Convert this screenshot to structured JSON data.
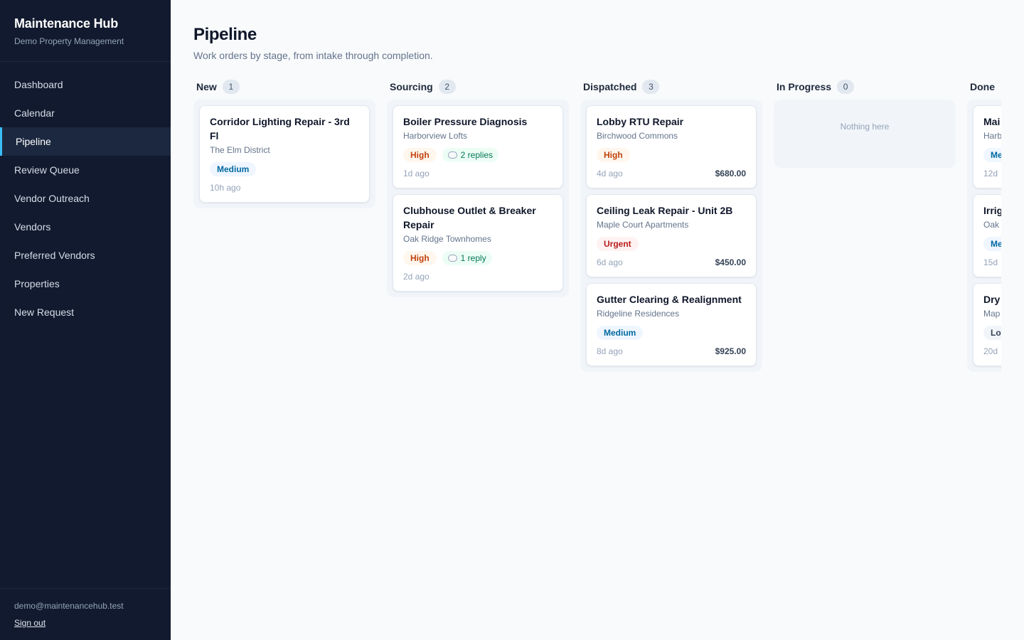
{
  "app": {
    "title": "Maintenance Hub",
    "subtitle": "Demo Property Management"
  },
  "nav": [
    {
      "label": "Dashboard",
      "active": false
    },
    {
      "label": "Calendar",
      "active": false
    },
    {
      "label": "Pipeline",
      "active": true
    },
    {
      "label": "Review Queue",
      "active": false
    },
    {
      "label": "Vendor Outreach",
      "active": false
    },
    {
      "label": "Vendors",
      "active": false
    },
    {
      "label": "Preferred Vendors",
      "active": false
    },
    {
      "label": "Properties",
      "active": false
    },
    {
      "label": "New Request",
      "active": false
    }
  ],
  "user": {
    "email": "demo@maintenancehub.test",
    "sign_out": "Sign out"
  },
  "page": {
    "title": "Pipeline",
    "subtitle": "Work orders by stage, from intake through completion."
  },
  "colors": {
    "sidebar": "#111a2e",
    "accent": "#38bdf8",
    "high": "#c2410c",
    "medium": "#0369a1",
    "urgent": "#b91c1c"
  },
  "columns": [
    {
      "title": "New",
      "count": "1",
      "empty_text": "",
      "cards": [
        {
          "title": "Corridor Lighting Repair - 3rd Fl",
          "property": "The Elm District",
          "priority": "Medium",
          "priority_class": "medium",
          "replies": "",
          "age": "10h ago",
          "amount": ""
        }
      ]
    },
    {
      "title": "Sourcing",
      "count": "2",
      "empty_text": "",
      "cards": [
        {
          "title": "Boiler Pressure Diagnosis",
          "property": "Harborview Lofts",
          "priority": "High",
          "priority_class": "high",
          "replies": "2 replies",
          "age": "1d ago",
          "amount": ""
        },
        {
          "title": "Clubhouse Outlet & Breaker Repair",
          "property": "Oak Ridge Townhomes",
          "priority": "High",
          "priority_class": "high",
          "replies": "1 reply",
          "age": "2d ago",
          "amount": ""
        }
      ]
    },
    {
      "title": "Dispatched",
      "count": "3",
      "empty_text": "",
      "cards": [
        {
          "title": "Lobby RTU Repair",
          "property": "Birchwood Commons",
          "priority": "High",
          "priority_class": "high",
          "replies": "",
          "age": "4d ago",
          "amount": "$680.00"
        },
        {
          "title": "Ceiling Leak Repair - Unit 2B",
          "property": "Maple Court Apartments",
          "priority": "Urgent",
          "priority_class": "urgent",
          "replies": "",
          "age": "6d ago",
          "amount": "$450.00"
        },
        {
          "title": "Gutter Clearing & Realignment",
          "property": "Ridgeline Residences",
          "priority": "Medium",
          "priority_class": "medium",
          "replies": "",
          "age": "8d ago",
          "amount": "$925.00"
        }
      ]
    },
    {
      "title": "In Progress",
      "count": "0",
      "empty_text": "Nothing here",
      "cards": []
    },
    {
      "title": "Done",
      "count": "",
      "empty_text": "",
      "cards": [
        {
          "title": "Mai",
          "property": "Harb",
          "priority": "Me",
          "priority_class": "medium",
          "replies": "",
          "age": "12d",
          "amount": ""
        },
        {
          "title": "Irrig",
          "property": "Oak",
          "priority": "Me",
          "priority_class": "medium",
          "replies": "",
          "age": "15d",
          "amount": ""
        },
        {
          "title": "Dry",
          "property": "Map",
          "priority": "Lo",
          "priority_class": "low",
          "replies": "",
          "age": "20d",
          "amount": ""
        }
      ]
    }
  ]
}
